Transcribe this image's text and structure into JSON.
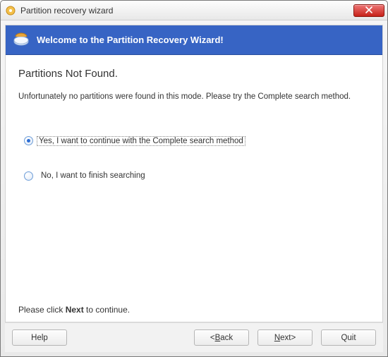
{
  "window": {
    "title": "Partition recovery wizard"
  },
  "banner": {
    "text": "Welcome to the Partition Recovery Wizard!"
  },
  "page": {
    "heading": "Partitions Not Found.",
    "body": "Unfortunately no partitions were found in this mode. Please try the Complete search method.",
    "option1": "Yes, I want to continue with the Complete search method",
    "option2": "No, I want to finish searching",
    "hint_pre": "Please click ",
    "hint_bold": "Next",
    "hint_post": " to continue."
  },
  "buttons": {
    "help": "Help",
    "back_u": "B",
    "back_rest": "ack",
    "back_prefix": "<",
    "next_u": "N",
    "next_rest": "ext>",
    "quit": "Quit"
  }
}
